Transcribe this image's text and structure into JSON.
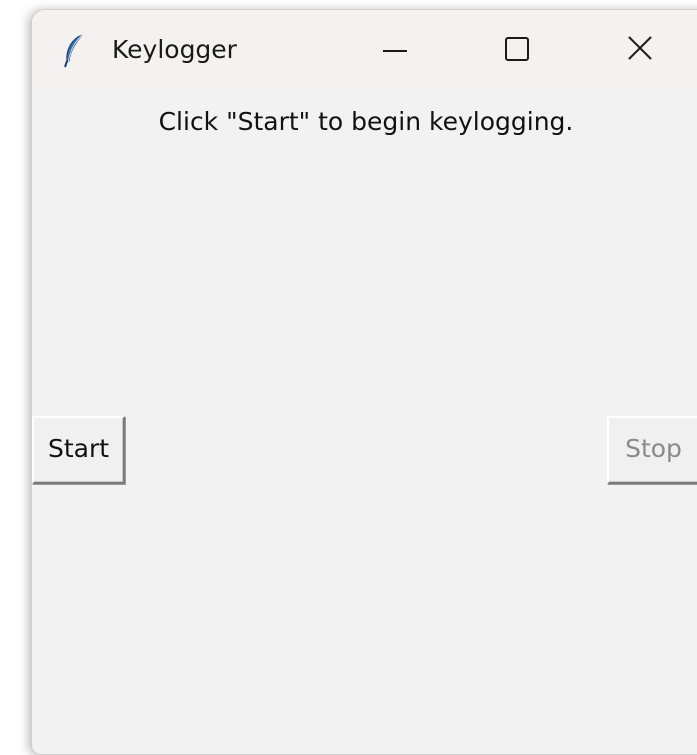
{
  "window": {
    "title": "Keylogger",
    "icon": "feather-icon",
    "controls": {
      "minimize": "minimize-icon",
      "maximize": "maximize-icon",
      "close": "close-icon"
    }
  },
  "main": {
    "instruction": "Click \"Start\" to begin keylogging.",
    "start_label": "Start",
    "stop_label": "Stop",
    "stop_enabled": false
  },
  "colors": {
    "background": "#f2f2f2",
    "titlebar": "#f6f1f1",
    "disabled_text": "#8a8a8a"
  }
}
